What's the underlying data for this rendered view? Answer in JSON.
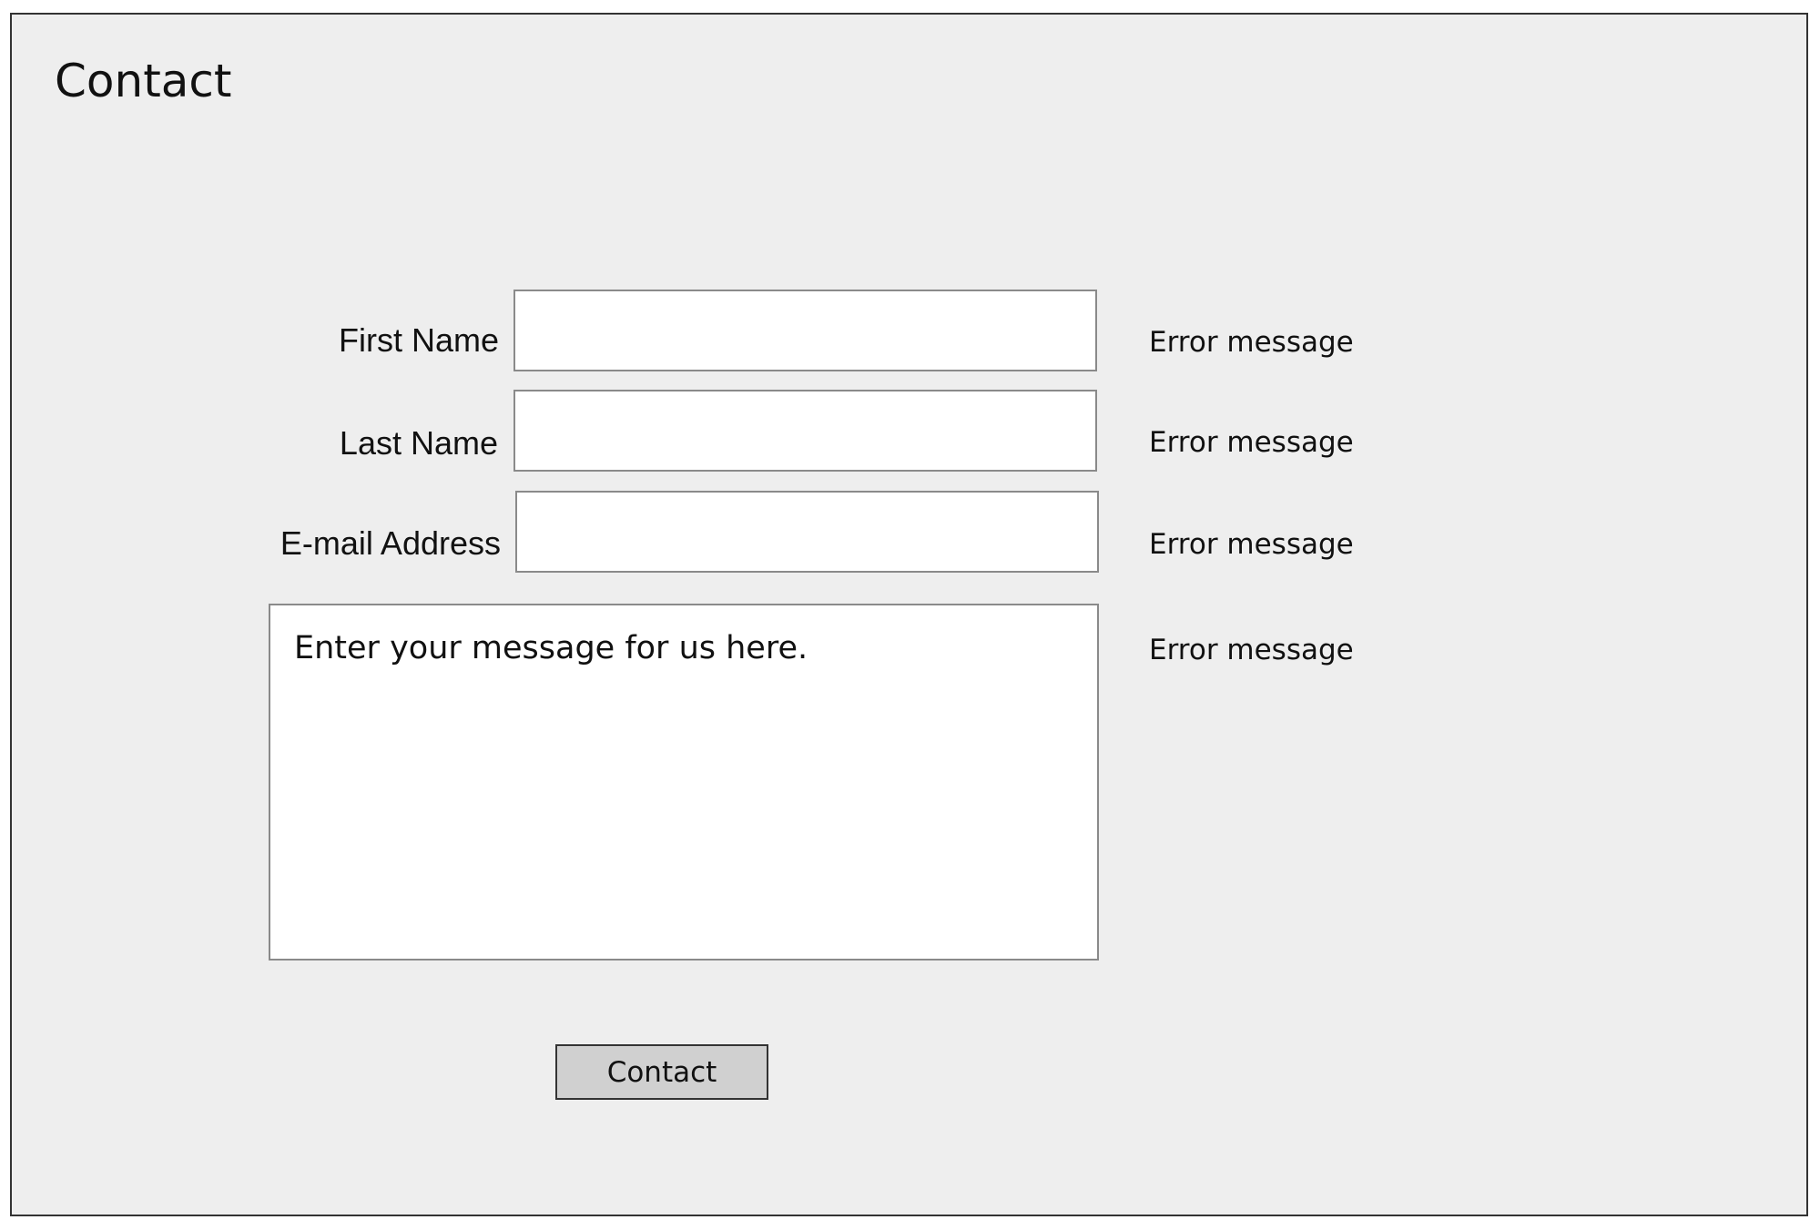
{
  "page": {
    "title": "Contact"
  },
  "form": {
    "first_name": {
      "label": "First Name",
      "value": "",
      "error": "Error message"
    },
    "last_name": {
      "label": "Last Name",
      "value": "",
      "error": "Error message"
    },
    "email": {
      "label": "E-mail Address",
      "value": "",
      "error": "Error message"
    },
    "message": {
      "placeholder": "Enter your message for us here.",
      "error": "Error message"
    },
    "submit_label": "Contact"
  },
  "colors": {
    "page_background": "#eeeeee",
    "field_background": "#ffffff",
    "button_background": "#d0d0d0",
    "border": "#333333"
  }
}
